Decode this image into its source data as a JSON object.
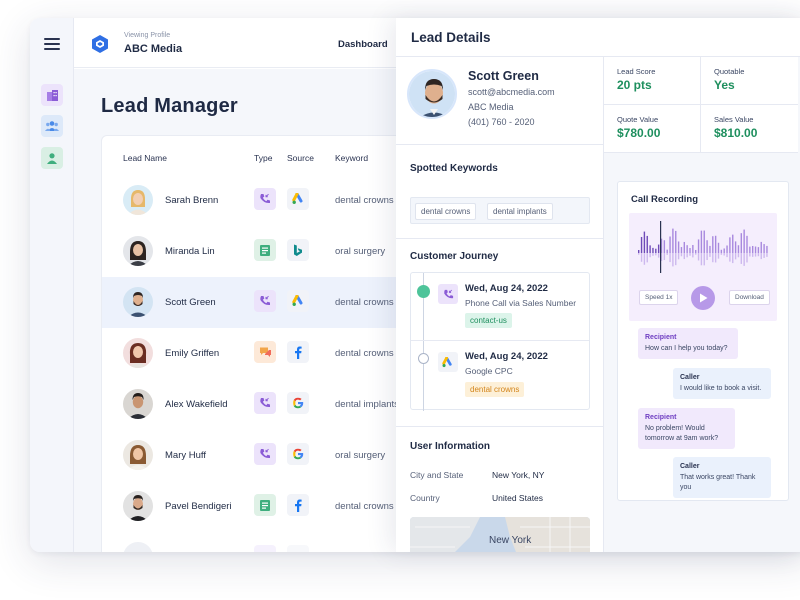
{
  "header": {
    "viewing_label": "Viewing Profile",
    "company": "ABC Media",
    "nav_dashboard": "Dashboard"
  },
  "page": {
    "title": "Lead Manager"
  },
  "table": {
    "columns": [
      "Lead Name",
      "Type",
      "Source",
      "Keyword"
    ],
    "rows": [
      {
        "name": "Sarah Brenn",
        "type": "phone-call",
        "source": "google-ads",
        "keyword": "dental crowns",
        "selected": false
      },
      {
        "name": "Miranda Lin",
        "type": "form",
        "source": "bing",
        "keyword": "oral surgery",
        "selected": false
      },
      {
        "name": "Scott Green",
        "type": "phone-call",
        "source": "google-ads",
        "keyword": "dental crowns",
        "selected": true
      },
      {
        "name": "Emily Griffen",
        "type": "chat",
        "source": "facebook",
        "keyword": "dental crowns",
        "selected": false
      },
      {
        "name": "Alex Wakefield",
        "type": "phone-call",
        "source": "google",
        "keyword": "dental implants",
        "selected": false
      },
      {
        "name": "Mary Huff",
        "type": "phone-call",
        "source": "google",
        "keyword": "oral surgery",
        "selected": false
      },
      {
        "name": "Pavel Bendigeri",
        "type": "form",
        "source": "facebook",
        "keyword": "dental crowns",
        "selected": false
      }
    ]
  },
  "details": {
    "title": "Lead Details",
    "name": "Scott Green",
    "email": "scott@abcmedia.com",
    "company": "ABC Media",
    "phone": "(401) 760 - 2020",
    "metrics": [
      {
        "label": "Lead Score",
        "value": "20 pts"
      },
      {
        "label": "Quotable",
        "value": "Yes"
      },
      {
        "label": "Quote Value",
        "value": "$780.00"
      },
      {
        "label": "Sales Value",
        "value": "$810.00"
      }
    ],
    "keywords_title": "Spotted Keywords",
    "keywords": [
      "dental crowns",
      "dental implants"
    ],
    "journey_title": "Customer Journey",
    "journey": [
      {
        "date": "Wed, Aug 24, 2022",
        "desc": "Phone Call via Sales Number",
        "tag": "contact-us"
      },
      {
        "date": "Wed, Aug 24, 2022",
        "desc": "Google CPC",
        "tag": "dental crowns"
      }
    ],
    "user_info_title": "User Information",
    "user_info": [
      {
        "label": "City and State",
        "value": "New York, NY"
      },
      {
        "label": "Country",
        "value": "United States"
      }
    ],
    "map_label": "New York"
  },
  "call": {
    "title": "Call Recording",
    "speed": "Speed 1x",
    "download": "Download",
    "messages": [
      {
        "who": "Recipient",
        "text": "How can I help you today?"
      },
      {
        "who": "Caller",
        "text": "I would like to book a visit."
      },
      {
        "who": "Recipient",
        "text": "No problem! Would tomorrow at 9am work?"
      },
      {
        "who": "Caller",
        "text": "That works great! Thank you"
      }
    ]
  },
  "colors": {
    "accent": "#2f6fe4",
    "green": "#1e8f5e",
    "purple": "#8b5cd6",
    "selected_row": "#edf2fc"
  }
}
